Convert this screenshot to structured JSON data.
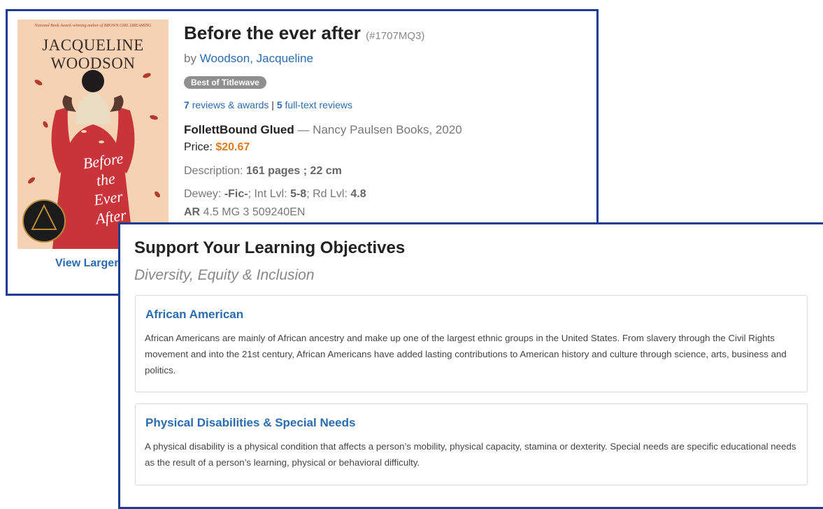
{
  "product": {
    "cover": {
      "tagline": "National Book Award–winning author of BROWN GIRL DREAMING",
      "author_line1": "JACQUELINE",
      "author_line2": "WOODSON",
      "title_line1": "Before",
      "title_line2": "the",
      "title_line3": "Ever",
      "title_line4": "After"
    },
    "view_larger": "View Larger",
    "title": "Before the ever after",
    "item_id": "(#1707MQ3)",
    "by_prefix": "by",
    "author": "Woodson, Jacqueline",
    "badge": "Best of Titlewave",
    "reviews_count": "7",
    "reviews_label": "reviews & awards",
    "reviews_sep": "|",
    "fulltext_count": "5",
    "fulltext_label": "full-text reviews",
    "binding": "FollettBound Glued",
    "publisher": "— Nancy Paulsen Books, 2020",
    "price_label": "Price:",
    "price": "$20.67",
    "description_label": "Description:",
    "description": "161 pages ; 22 cm",
    "dewey_label": "Dewey:",
    "dewey": "-Fic-",
    "int_lvl_label": "; Int Lvl:",
    "int_lvl": "5-8",
    "rd_lvl_label": "; Rd Lvl:",
    "rd_lvl": "4.8",
    "ar_label": "AR",
    "ar_value": "4.5 MG 3 509240EN"
  },
  "objectives": {
    "heading": "Support Your Learning Objectives",
    "subheading": "Diversity, Equity & Inclusion",
    "cards": [
      {
        "title": "African American",
        "text": "African Americans are mainly of African ancestry and make up one of the largest ethnic groups in the United States. From slavery through the Civil Rights movement and into the 21st century, African Americans have added lasting contributions to American history and culture through science, arts, business and politics."
      },
      {
        "title": "Physical Disabilities & Special Needs",
        "text": "A physical disability is a physical condition that affects a person’s mobility, physical capacity, stamina or dexterity. Special needs are specific educational needs as the result of a person’s learning, physical or behavioral difficulty."
      }
    ]
  },
  "colors": {
    "panel_border": "#1d3d8f",
    "link": "#2b6cb0",
    "price": "#e07a1f",
    "badge": "#8f8f8f"
  }
}
